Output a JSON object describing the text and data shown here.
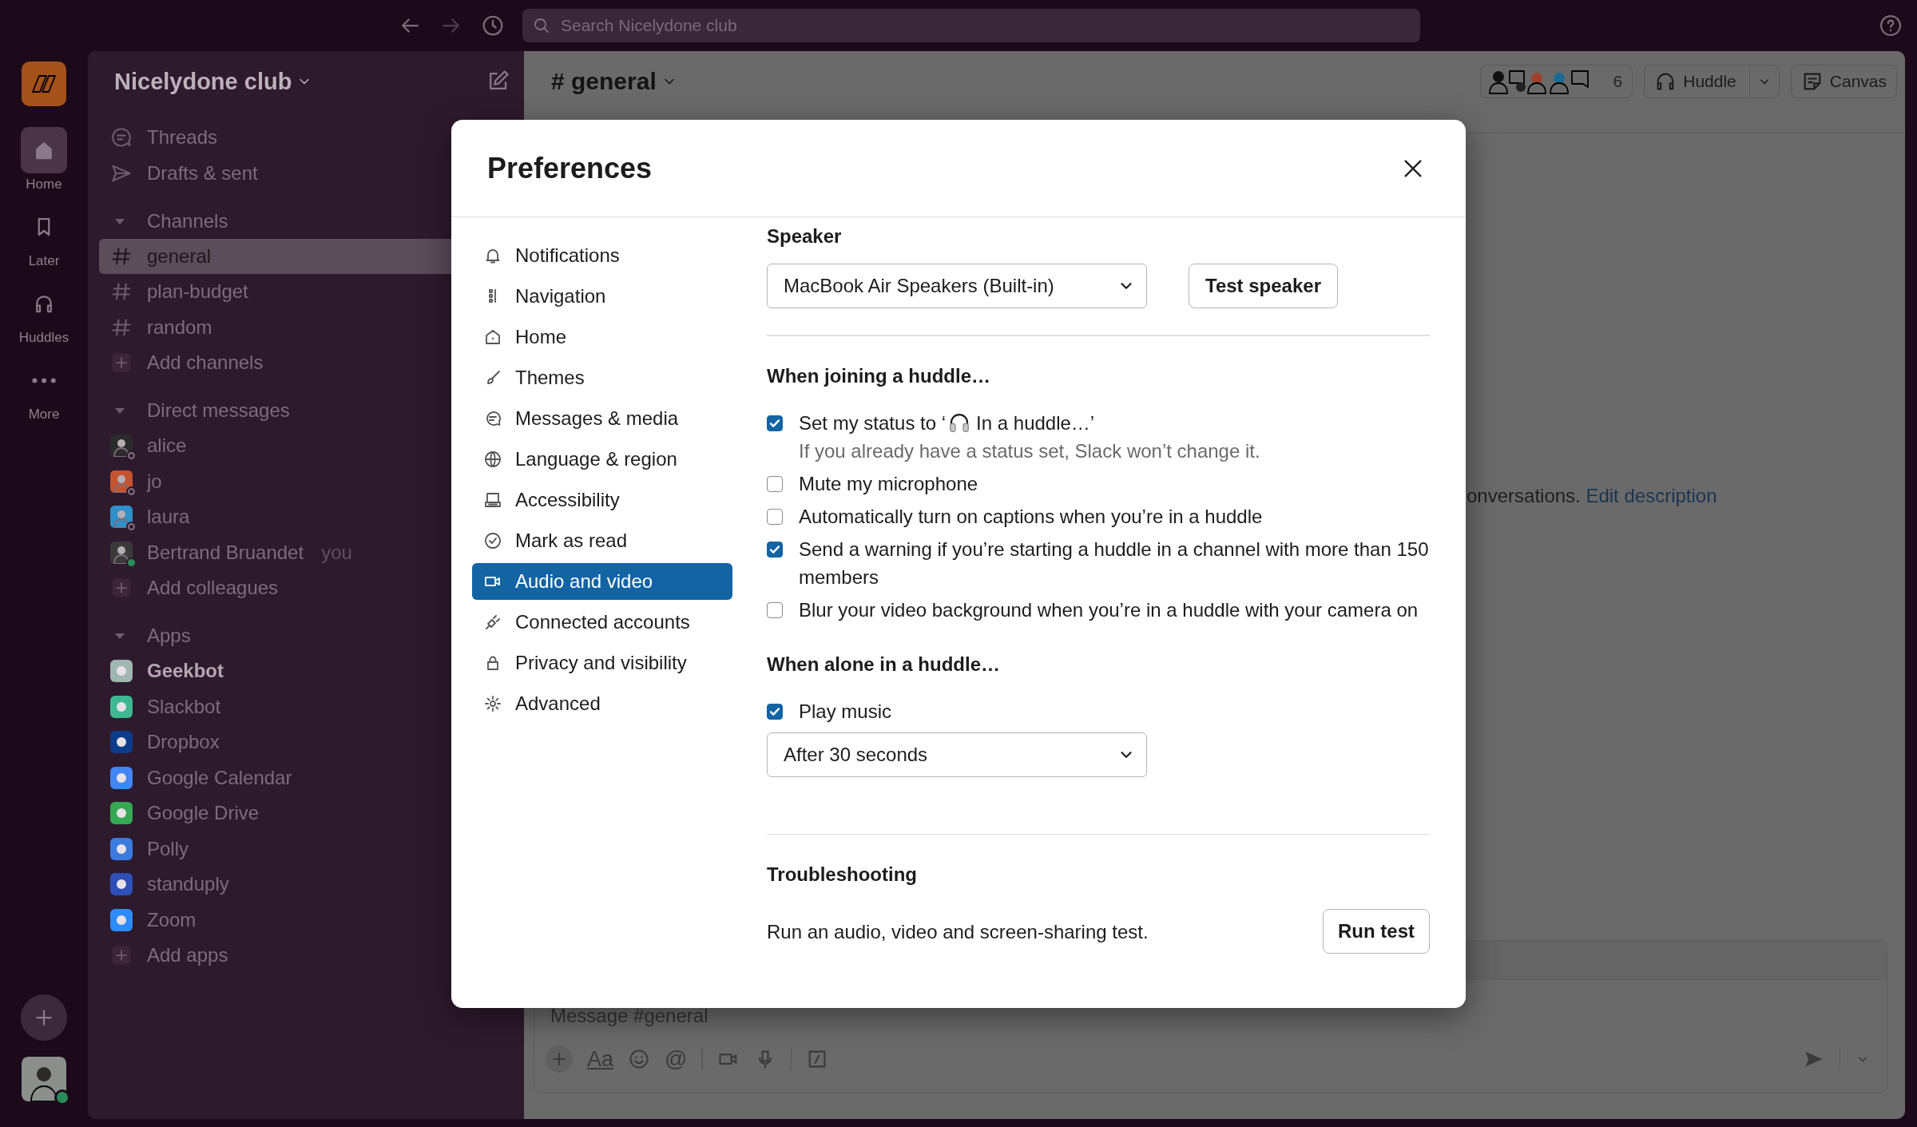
{
  "top_bar": {
    "search": {
      "placeholder": "Search Nicelydone club"
    }
  },
  "rail": {
    "items": [
      {
        "label": "Home",
        "selected": true
      },
      {
        "label": "Later",
        "selected": false
      },
      {
        "label": "Huddles",
        "selected": false
      },
      {
        "label": "More",
        "selected": false
      }
    ]
  },
  "sidebar": {
    "workspace": "Nicelydone club",
    "shortcuts": [
      {
        "label": "Threads"
      },
      {
        "label": "Drafts & sent"
      }
    ],
    "sections": [
      {
        "title": "Channels",
        "expanded": true,
        "items": [
          {
            "kind": "channel",
            "label": "general",
            "selected": true
          },
          {
            "kind": "channel",
            "label": "plan-budget",
            "selected": false
          },
          {
            "kind": "channel",
            "label": "random",
            "selected": false
          },
          {
            "kind": "add",
            "label": "Add channels",
            "selected": false
          }
        ]
      },
      {
        "title": "Direct messages",
        "expanded": true,
        "items": [
          {
            "kind": "person",
            "label": "alice",
            "color": "#2b2b2b",
            "online": false,
            "selected": false
          },
          {
            "kind": "person",
            "label": "jo",
            "color": "#c5532e",
            "online": false,
            "selected": false
          },
          {
            "kind": "person",
            "label": "laura",
            "color": "#2f8fc9",
            "online": false,
            "selected": false
          },
          {
            "kind": "person",
            "label": "Bertrand Bruandet",
            "tag": "you",
            "color": "#3a3a3a",
            "online": true,
            "selected": false
          },
          {
            "kind": "add",
            "label": "Add colleagues",
            "selected": false
          }
        ]
      },
      {
        "title": "Apps",
        "expanded": true,
        "items": [
          {
            "kind": "app",
            "label": "Geekbot",
            "color": "#9fb7b0",
            "unread": true,
            "selected": false
          },
          {
            "kind": "app",
            "label": "Slackbot",
            "color": "#3eb890",
            "unread": false,
            "selected": false
          },
          {
            "kind": "app",
            "label": "Dropbox",
            "color": "#0d3c8a",
            "unread": false,
            "selected": false
          },
          {
            "kind": "app",
            "label": "Google Calendar",
            "color": "#4285f4",
            "unread": false,
            "selected": false
          },
          {
            "kind": "app",
            "label": "Google Drive",
            "color": "#34a853",
            "unread": false,
            "selected": false
          },
          {
            "kind": "app",
            "label": "Polly",
            "color": "#3b7be0",
            "unread": false,
            "selected": false
          },
          {
            "kind": "app",
            "label": "standuply",
            "color": "#2e4fb8",
            "unread": false,
            "selected": false
          },
          {
            "kind": "app",
            "label": "Zoom",
            "color": "#2d8cff",
            "unread": false,
            "selected": false
          },
          {
            "kind": "add",
            "label": "Add apps",
            "selected": false
          }
        ]
      }
    ]
  },
  "channel": {
    "name": "# general",
    "member_count": "6",
    "huddle_button": "Huddle",
    "canvas_button": "Canvas",
    "description_text": "onversations.",
    "description_link": "Edit description",
    "composer": {
      "placeholder": "Message #general",
      "format_label": "Aa",
      "mention_label": "@"
    }
  },
  "modal": {
    "title": "Preferences",
    "nav": [
      {
        "label": "Notifications",
        "selected": false
      },
      {
        "label": "Navigation",
        "selected": false
      },
      {
        "label": "Home",
        "selected": false
      },
      {
        "label": "Themes",
        "selected": false
      },
      {
        "label": "Messages & media",
        "selected": false
      },
      {
        "label": "Language & region",
        "selected": false
      },
      {
        "label": "Accessibility",
        "selected": false
      },
      {
        "label": "Mark as read",
        "selected": false
      },
      {
        "label": "Audio and video",
        "selected": true
      },
      {
        "label": "Connected accounts",
        "selected": false
      },
      {
        "label": "Privacy and visibility",
        "selected": false
      },
      {
        "label": "Advanced",
        "selected": false
      }
    ],
    "speaker": {
      "label": "Speaker",
      "device": "MacBook Air Speakers (Built-in)",
      "button": "Test speaker"
    },
    "joining": {
      "title": "When joining a huddle…",
      "options": [
        {
          "kind": "status",
          "label": "Set my status to ‘",
          "label_end": "In a huddle…’",
          "hint": "If you already have a status set, Slack won’t change it.",
          "checked": true
        },
        {
          "kind": "plain",
          "label": "Mute my microphone",
          "checked": false
        },
        {
          "kind": "plain",
          "label": "Automatically turn on captions when you’re in a huddle",
          "checked": false
        },
        {
          "kind": "plain",
          "label": "Send a warning if you’re starting a huddle in a channel with more than 150 members",
          "checked": true
        },
        {
          "kind": "plain",
          "label": "Blur your video background when you’re in a huddle with your camera on",
          "checked": false
        }
      ]
    },
    "alone": {
      "title": "When alone in a huddle…",
      "option": {
        "label": "Play music",
        "checked": true
      },
      "delay": "After 30 seconds"
    },
    "troubleshooting": {
      "title": "Troubleshooting",
      "text": "Run an audio, video and screen-sharing test.",
      "button": "Run test"
    }
  }
}
